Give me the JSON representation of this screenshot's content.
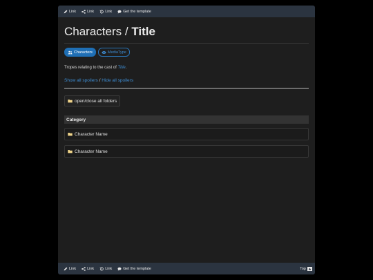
{
  "nav": {
    "links": [
      {
        "label": "Link",
        "icon": "pencil-icon"
      },
      {
        "label": "Link",
        "icon": "share-icon"
      },
      {
        "label": "Link",
        "icon": "history-icon"
      },
      {
        "label": "Get the template",
        "icon": "comment-icon"
      }
    ],
    "top_label": "Top"
  },
  "header": {
    "title_prefix": "Characters / ",
    "title_main": "Title"
  },
  "tabs": [
    {
      "label": "Characters",
      "icon": "users-icon",
      "active": true
    },
    {
      "label": "MediaType",
      "icon": "eye-icon",
      "active": false
    }
  ],
  "description": {
    "text": "Tropes relating to the cast of ",
    "link": "Title",
    "suffix": "."
  },
  "spoilers": {
    "show": "Show all spoilers",
    "separator": " / ",
    "hide": "Hide all spoilers"
  },
  "folders": {
    "toggle_label": "open/close all folders",
    "category": "Category",
    "items": [
      "Character Name",
      "Character Name"
    ]
  },
  "colors": {
    "accent": "#1f6fb5",
    "link": "#3d8bd0",
    "bar": "#2b3440",
    "background": "#1e1e1e",
    "folder": "#f0d48a"
  }
}
